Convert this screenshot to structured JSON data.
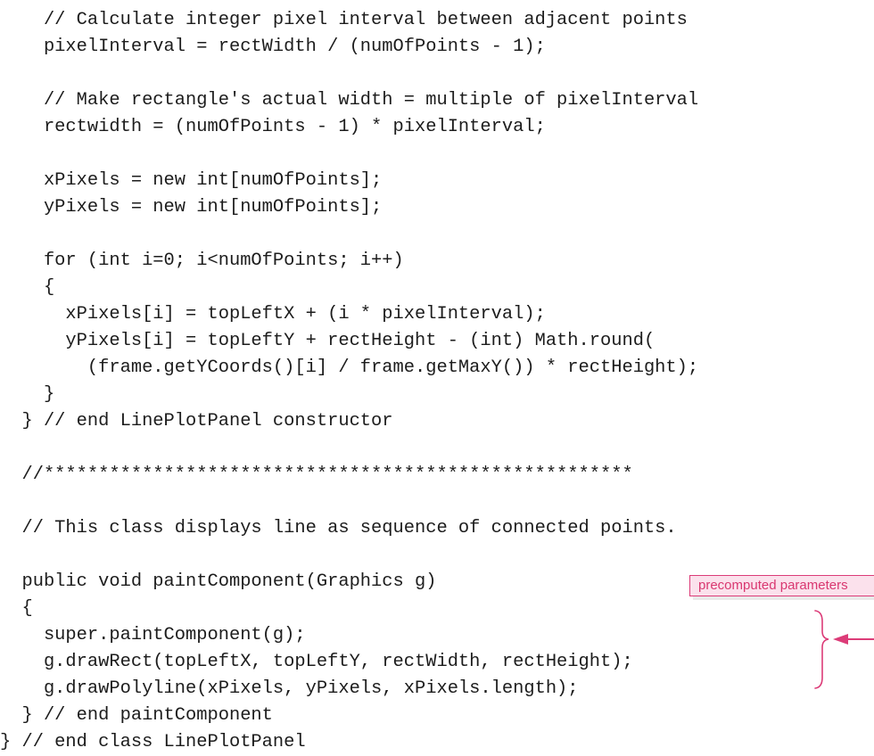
{
  "code_lines": [
    "    // Calculate integer pixel interval between adjacent points",
    "    pixelInterval = rectWidth / (numOfPoints - 1);",
    "",
    "    // Make rectangle's actual width = multiple of pixelInterval",
    "    rectwidth = (numOfPoints - 1) * pixelInterval;",
    "",
    "    xPixels = new int[numOfPoints];",
    "    yPixels = new int[numOfPoints];",
    "",
    "    for (int i=0; i<numOfPoints; i++)",
    "    {",
    "      xPixels[i] = topLeftX + (i * pixelInterval);",
    "      yPixels[i] = topLeftY + rectHeight - (int) Math.round(",
    "        (frame.getYCoords()[i] / frame.getMaxY()) * rectHeight);",
    "    }",
    "  } // end LinePlotPanel constructor",
    "",
    "  //******************************************************",
    "",
    "  // This class displays line as sequence of connected points.",
    "",
    "  public void paintComponent(Graphics g)",
    "  {",
    "    super.paintComponent(g);",
    "    g.drawRect(topLeftX, topLeftY, rectWidth, rectHeight);",
    "    g.drawPolyline(xPixels, yPixels, xPixels.length);",
    "  } // end paintComponent",
    "} // end class LinePlotPanel"
  ],
  "callout": {
    "text": "precomputed parameters"
  },
  "colors": {
    "code_text": "#1c1c1c",
    "annotation": "#dc3c78",
    "callout_fill": "#fbe1ec"
  }
}
